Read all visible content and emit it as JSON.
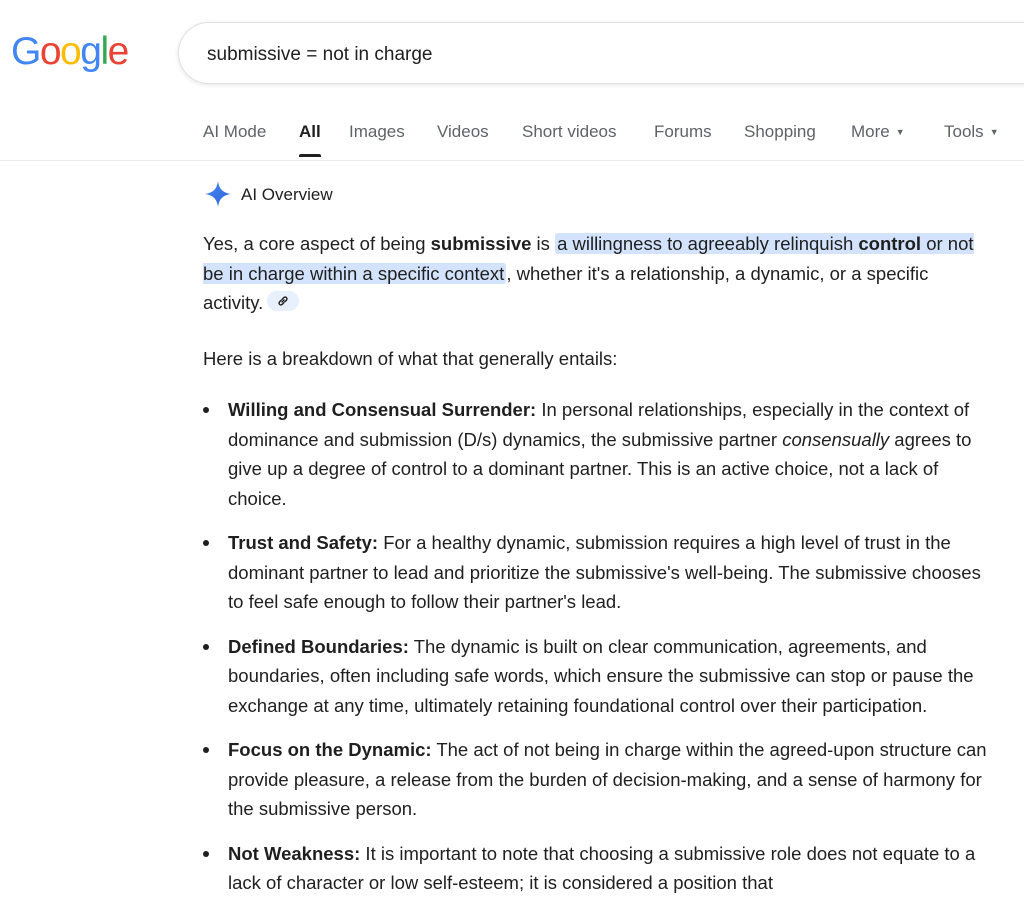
{
  "logo": {
    "text": "Google"
  },
  "search": {
    "query": "submissive = not in charge"
  },
  "tabs": [
    {
      "label": "AI Mode"
    },
    {
      "label": "All",
      "active": true
    },
    {
      "label": "Images"
    },
    {
      "label": "Videos"
    },
    {
      "label": "Short videos"
    },
    {
      "label": "Forums"
    },
    {
      "label": "Shopping"
    },
    {
      "label": "More",
      "dropdown": true
    },
    {
      "label": "Tools",
      "dropdown": true
    }
  ],
  "ai_overview": {
    "title": "AI Overview",
    "icon": "sparkle-icon",
    "summary": {
      "pre": "Yes, a core aspect of being ",
      "bold": "submissive",
      "mid": " is ",
      "hl_1": "a willingness to agreeably relinquish ",
      "hl_bold": "control",
      "hl_2": " or not be in charge within a specific context",
      "post": ", whether it's a relationship, a dynamic, or a specific activity."
    },
    "link_icon": "link-icon",
    "intro": "Here is a breakdown of what that generally entails:",
    "points": [
      {
        "title": "Willing and Consensual Surrender:",
        "text_pre": " In personal relationships, especially in the context of dominance and submission (D/s) dynamics, the submissive partner ",
        "text_em": "consensually",
        "text_post": " agrees to give up a degree of control to a dominant partner. This is an active choice, not a lack of choice."
      },
      {
        "title": "Trust and Safety:",
        "text": " For a healthy dynamic, submission requires a high level of trust in the dominant partner to lead and prioritize the submissive's well-being. The submissive chooses to feel safe enough to follow their partner's lead."
      },
      {
        "title": "Defined Boundaries:",
        "text": " The dynamic is built on clear communication, agreements, and boundaries, often including safe words, which ensure the submissive can stop or pause the exchange at any time, ultimately retaining foundational control over their participation."
      },
      {
        "title": "Focus on the Dynamic:",
        "text": " The act of not being in charge within the agreed-upon structure can provide pleasure, a release from the burden of decision-making, and a sense of harmony for the submissive person."
      },
      {
        "title": "Not Weakness:",
        "text": " It is important to note that choosing a submissive role does not equate to a lack of character or low self-esteem; it is considered a position that"
      }
    ]
  },
  "colors": {
    "highlight": "#d3e3fd",
    "text": "#1f1f1f",
    "muted": "#5f6368",
    "google_blue": "#4285f4",
    "google_red": "#ea4335",
    "google_yellow": "#fbbc05",
    "google_green": "#34a853"
  }
}
